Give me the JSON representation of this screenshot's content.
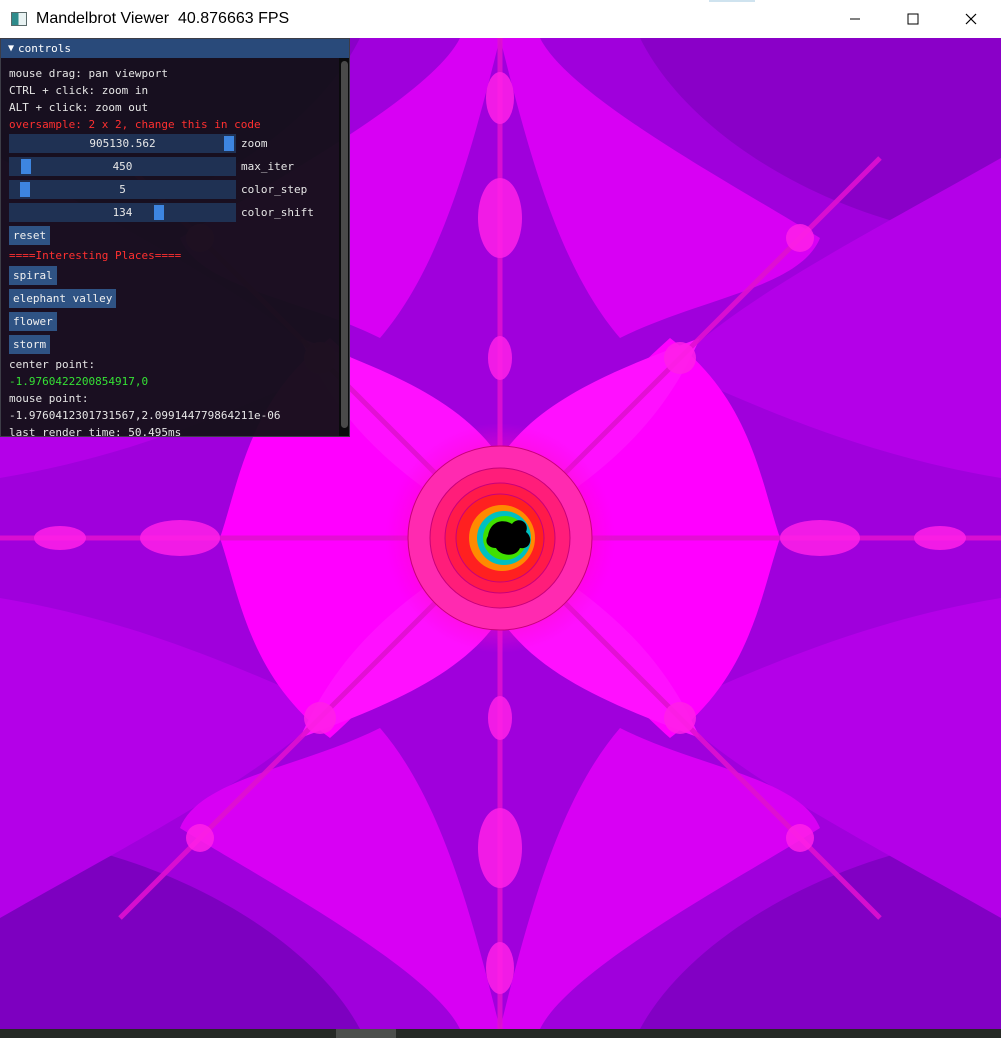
{
  "window": {
    "title": "Mandelbrot Viewer  40.876663 FPS",
    "icons": {
      "app": "app-icon",
      "minimize": "minimize-icon",
      "maximize": "maximize-icon",
      "close": "close-icon"
    }
  },
  "panel": {
    "title": "controls",
    "help_lines": [
      "mouse drag: pan viewport",
      "CTRL + click: zoom in",
      "ALT + click: zoom out"
    ],
    "oversample_note": "oversample: 2 x 2, change this in code",
    "sliders": [
      {
        "label": "zoom",
        "value": "905130.562",
        "fraction": 0.97
      },
      {
        "label": "max_iter",
        "value": "450",
        "fraction": 0.05
      },
      {
        "label": "color_step",
        "value": "5",
        "fraction": 0.04
      },
      {
        "label": "color_shift",
        "value": "134",
        "fraction": 0.64
      }
    ],
    "reset_button": "reset",
    "places_heading": "====Interesting Places====",
    "places": [
      "spiral",
      "elephant valley",
      "flower",
      "storm"
    ],
    "center_label": "center point:",
    "center_value": "-1.9760422200854917,0",
    "mouse_label": "mouse point:",
    "mouse_value": "-1.9760412301731567,2.099144779864211e-06",
    "render_time": "last render time: 50.495ms"
  },
  "colors": {
    "panel_header": "#294a7a",
    "slider_grab": "#3d85e0",
    "fractal_magenta": "#ff00ff",
    "fractal_purple": "#9b00d8",
    "fractal_core": "#000000"
  }
}
